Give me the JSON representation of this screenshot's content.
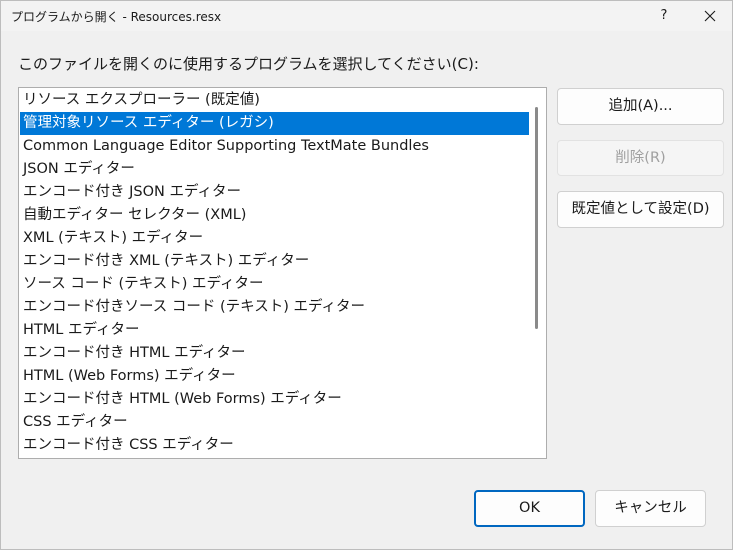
{
  "window": {
    "title": "プログラムから開く - Resources.resx",
    "help_label": "?",
    "close_icon": "close-icon"
  },
  "prompt": "このファイルを開くのに使用するプログラムを選択してください(C):",
  "programs": [
    {
      "label": "リソース エクスプローラー (既定値)",
      "selected": false
    },
    {
      "label": "管理対象リソース エディター (レガシ)",
      "selected": true
    },
    {
      "label": "Common Language Editor Supporting TextMate Bundles",
      "selected": false
    },
    {
      "label": "JSON エディター",
      "selected": false
    },
    {
      "label": "エンコード付き JSON エディター",
      "selected": false
    },
    {
      "label": "自動エディター セレクター (XML)",
      "selected": false
    },
    {
      "label": "XML (テキスト) エディター",
      "selected": false
    },
    {
      "label": "エンコード付き XML (テキスト) エディター",
      "selected": false
    },
    {
      "label": "ソース コード (テキスト) エディター",
      "selected": false
    },
    {
      "label": "エンコード付きソース コード (テキスト) エディター",
      "selected": false
    },
    {
      "label": "HTML エディター",
      "selected": false
    },
    {
      "label": "エンコード付き HTML エディター",
      "selected": false
    },
    {
      "label": "HTML (Web Forms) エディター",
      "selected": false
    },
    {
      "label": "エンコード付き HTML (Web Forms) エディター",
      "selected": false
    },
    {
      "label": "CSS エディター",
      "selected": false
    },
    {
      "label": "エンコード付き CSS エディター",
      "selected": false
    }
  ],
  "side_buttons": {
    "add": "追加(A)...",
    "remove": "削除(R)",
    "set_default": "既定値として設定(D)"
  },
  "footer": {
    "ok": "OK",
    "cancel": "キャンセル"
  },
  "colors": {
    "selection": "#0078d7",
    "ok_border": "#0067c0"
  }
}
